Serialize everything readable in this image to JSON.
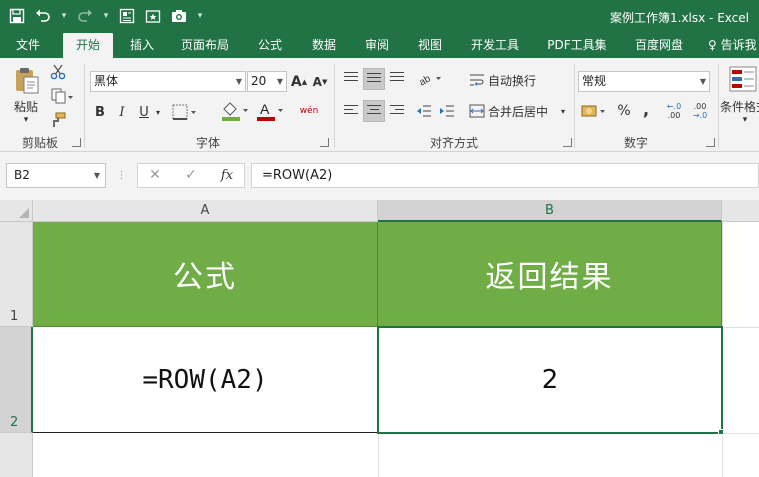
{
  "window": {
    "title": "案例工作簿1.xlsx - Excel"
  },
  "qat": {
    "save_icon": "save-icon",
    "undo_icon": "undo-icon",
    "redo_icon": "redo-icon",
    "customize_arrow": "▾"
  },
  "tabs": [
    {
      "label": "文件"
    },
    {
      "label": "开始"
    },
    {
      "label": "插入"
    },
    {
      "label": "页面布局"
    },
    {
      "label": "公式"
    },
    {
      "label": "数据"
    },
    {
      "label": "审阅"
    },
    {
      "label": "视图"
    },
    {
      "label": "开发工具"
    },
    {
      "label": "PDF工具集"
    },
    {
      "label": "百度网盘"
    },
    {
      "label": "告诉我"
    }
  ],
  "ribbon": {
    "clipboard": {
      "paste_label": "粘贴",
      "group_label": "剪贴板"
    },
    "font": {
      "font_name": "黑体",
      "font_size": "20",
      "bold": "B",
      "italic": "I",
      "underline": "U",
      "grow": "A",
      "shrink": "A",
      "font_color_glyph": "A",
      "phonetic": "wén",
      "group_label": "字体"
    },
    "alignment": {
      "wrap_text": "自动换行",
      "merge_center": "合并后居中",
      "group_label": "对齐方式"
    },
    "number": {
      "format": "常规",
      "percent": "%",
      "comma": ",",
      "increase_decimal": ".00",
      "decrease_decimal": ".0",
      "group_label": "数字"
    },
    "styles": {
      "conditional_format": "条件格式"
    },
    "colors": {
      "accent": "#217346",
      "header_fill": "#70ad47"
    }
  },
  "formula_bar": {
    "name_box": "B2",
    "cancel_glyph": "✕",
    "enter_glyph": "✓",
    "fx_glyph": "fx",
    "formula": "=ROW(A2)"
  },
  "sheet": {
    "columns": [
      "A",
      "B"
    ],
    "rows": [
      "1",
      "2"
    ],
    "cells": {
      "A1": "公式",
      "B1": "返回结果",
      "A2": "=ROW(A2)",
      "B2": "2"
    },
    "active_cell": "B2"
  }
}
